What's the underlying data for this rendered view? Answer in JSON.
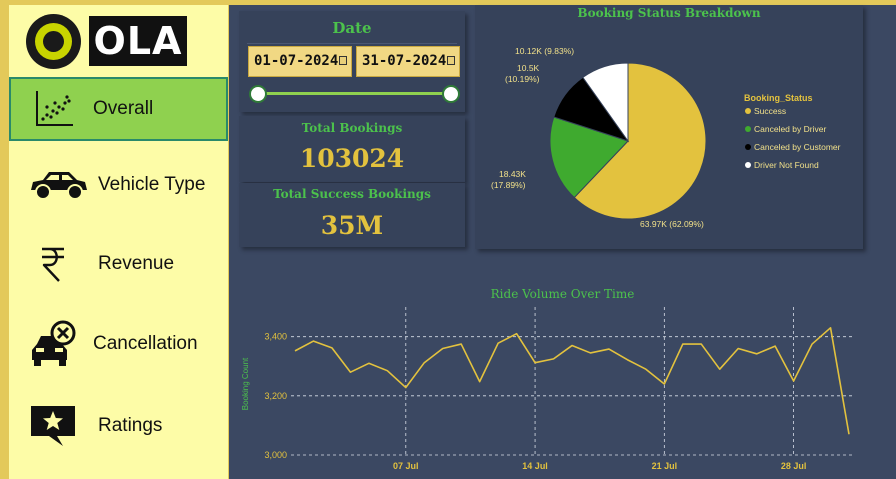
{
  "brand": {
    "name": "OLA"
  },
  "nav": {
    "items": [
      {
        "label": "Overall",
        "icon": "scatter-chart-icon",
        "active": true
      },
      {
        "label": "Vehicle Type",
        "icon": "car-icon",
        "active": false
      },
      {
        "label": "Revenue",
        "icon": "rupee-icon",
        "active": false
      },
      {
        "label": "Cancellation",
        "icon": "car-cancel-icon",
        "active": false
      },
      {
        "label": "Ratings",
        "icon": "star-message-icon",
        "active": false
      }
    ]
  },
  "date_filter": {
    "title": "Date",
    "start": "01-07-2024",
    "end": "31-07-2024",
    "range_fraction": [
      0,
      1
    ]
  },
  "kpis": {
    "total_bookings_label": "Total Bookings",
    "total_bookings_value": "103024",
    "total_success_label": "Total Success Bookings",
    "total_success_value": "35M"
  },
  "colors": {
    "success": "#e3c23e",
    "driver_cancel": "#3faa2f",
    "customer_cancel": "#000000",
    "not_found": "#ffffff",
    "accent_green": "#4cc24c",
    "panel": "#36425a"
  },
  "chart_data": [
    {
      "type": "pie",
      "title": "Booking Status Breakdown",
      "legend_title": "Booking_Status",
      "legend_position": "right",
      "slices": [
        {
          "name": "Success",
          "value": 63.97,
          "label": "63.97K (62.09%)",
          "color": "#e3c23e"
        },
        {
          "name": "Canceled by Driver",
          "value": 18.43,
          "label_line1": "18.43K",
          "label_line2": "(17.89%)",
          "color": "#3faa2f"
        },
        {
          "name": "Canceled by Customer",
          "value": 10.5,
          "label_line1": "10.5K",
          "label_line2": "(10.19%)",
          "color": "#000000"
        },
        {
          "name": "Driver Not Found",
          "value": 10.12,
          "label": "10.12K (9.83%)",
          "color": "#ffffff"
        }
      ]
    },
    {
      "type": "line",
      "title": "Ride Volume Over Time",
      "ylabel": "Booking Count",
      "xlabel": "",
      "ylim": [
        3000,
        3480
      ],
      "yticks": [
        3000,
        3200,
        3400
      ],
      "ytick_labels": [
        "3,000",
        "3,200",
        "3,400"
      ],
      "xticks": [
        7,
        14,
        21,
        28
      ],
      "xtick_labels": [
        "07 Jul",
        "14 Jul",
        "21 Jul",
        "28 Jul"
      ],
      "grid": true,
      "x": [
        1,
        2,
        3,
        4,
        5,
        6,
        7,
        8,
        9,
        10,
        11,
        12,
        13,
        14,
        15,
        16,
        17,
        18,
        19,
        20,
        21,
        22,
        23,
        24,
        25,
        26,
        27,
        28,
        29,
        30,
        31
      ],
      "values": [
        3352,
        3385,
        3362,
        3280,
        3310,
        3285,
        3228,
        3312,
        3360,
        3375,
        3248,
        3378,
        3410,
        3312,
        3325,
        3370,
        3345,
        3358,
        3322,
        3290,
        3240,
        3375,
        3375,
        3290,
        3360,
        3342,
        3368,
        3250,
        3375,
        3430,
        3070
      ]
    }
  ]
}
